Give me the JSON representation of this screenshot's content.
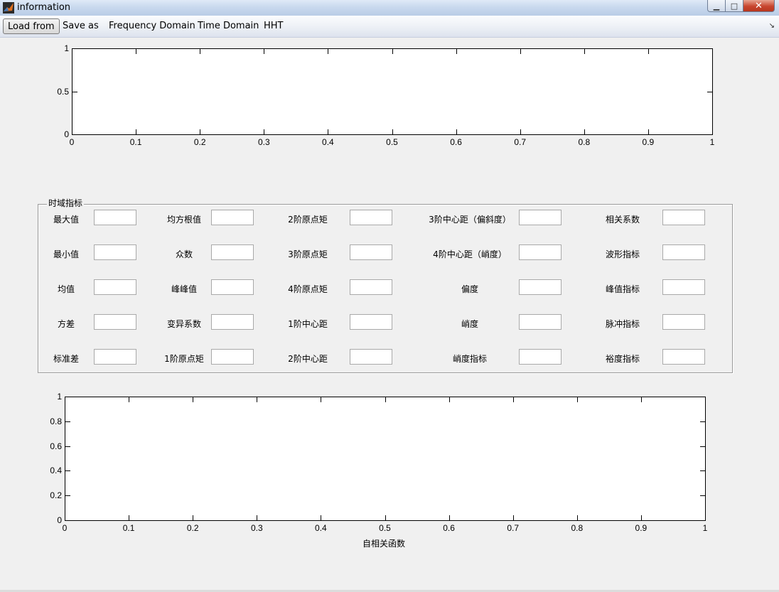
{
  "window": {
    "title": "information",
    "minimize": "▁",
    "maximize": "□",
    "close": "✕"
  },
  "toolbar": {
    "items": [
      "Load from",
      "Save as",
      "Frequency Domain",
      "Time Domain",
      "HHT"
    ],
    "overflow_icon": "↘"
  },
  "top_axes": {
    "x_ticks": [
      "0",
      "0.1",
      "0.2",
      "0.3",
      "0.4",
      "0.5",
      "0.6",
      "0.7",
      "0.8",
      "0.9",
      "1"
    ],
    "y_ticks": [
      "0",
      "0.5",
      "1"
    ]
  },
  "panel": {
    "title": "时域指标",
    "fields": [
      [
        "最大值",
        "均方根值",
        "2阶原点矩",
        "3阶中心距（偏斜度）",
        "相关系数"
      ],
      [
        "最小值",
        "众数",
        "3阶原点矩",
        "4阶中心距（峭度）",
        "波形指标"
      ],
      [
        "均值",
        "峰峰值",
        "4阶原点矩",
        "偏度",
        "峰值指标"
      ],
      [
        "方差",
        "变异系数",
        "1阶中心距",
        "峭度",
        "脉冲指标"
      ],
      [
        "标准差",
        "1阶原点矩",
        "2阶中心距",
        "峭度指标",
        "裕度指标"
      ]
    ]
  },
  "bottom_axes": {
    "x_ticks": [
      "0",
      "0.1",
      "0.2",
      "0.3",
      "0.4",
      "0.5",
      "0.6",
      "0.7",
      "0.8",
      "0.9",
      "1"
    ],
    "y_ticks": [
      "0",
      "0.2",
      "0.4",
      "0.6",
      "0.8",
      "1"
    ],
    "xlabel": "自相关函数"
  }
}
